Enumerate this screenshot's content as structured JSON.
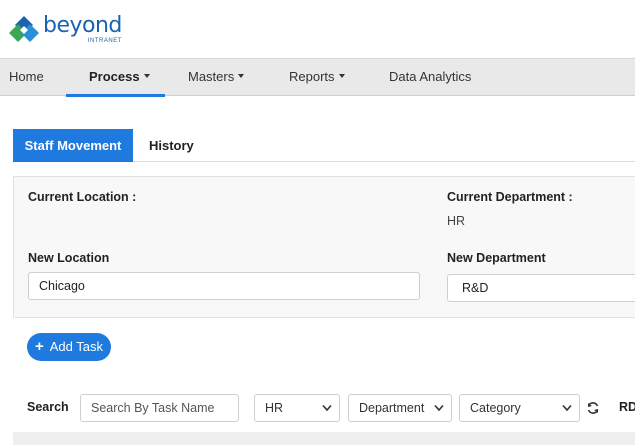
{
  "brand": {
    "name": "beyond",
    "subtitle": "INTRANET",
    "colors": {
      "primary": "#1f7ae0",
      "logo_blue": "#1b63b0",
      "logo_green": "#3aa757"
    }
  },
  "nav": {
    "items": [
      {
        "label": "Home",
        "dropdown": false
      },
      {
        "label": "Process",
        "dropdown": true,
        "active": true
      },
      {
        "label": "Masters",
        "dropdown": true
      },
      {
        "label": "Reports",
        "dropdown": true
      },
      {
        "label": "Data Analytics",
        "dropdown": false
      }
    ]
  },
  "tabs": [
    {
      "label": "Staff Movement",
      "active": true
    },
    {
      "label": "History",
      "active": false
    }
  ],
  "form": {
    "current_location_label": "Current Location :",
    "current_department_label": "Current Department :",
    "current_department_value": "HR",
    "new_location_label": "New Location",
    "new_location_value": "Chicago",
    "new_department_label": "New Department",
    "new_department_value": "R&D"
  },
  "actions": {
    "add_task_label": "Add Task",
    "add_icon": "plus-icon"
  },
  "filters": {
    "search_label": "Search",
    "search_placeholder": "Search By Task Name",
    "department_code_value": "HR",
    "department_value": "Department",
    "category_value": "Category",
    "refresh_icon": "refresh-icon",
    "trailing_text": "RD"
  }
}
